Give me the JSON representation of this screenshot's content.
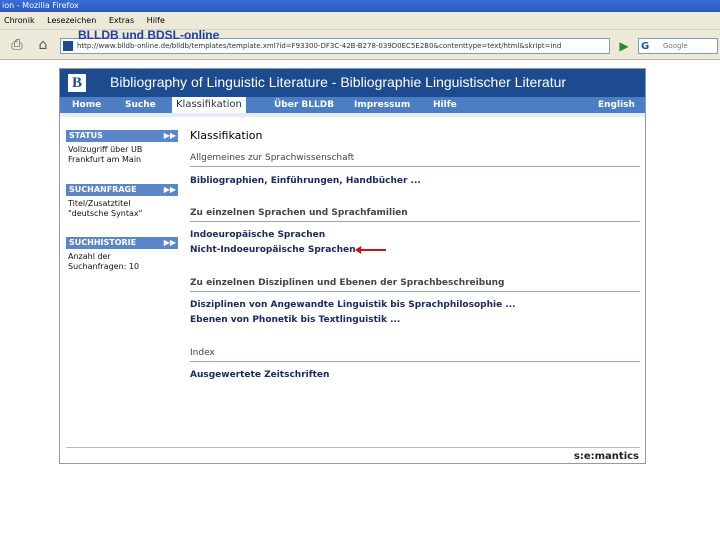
{
  "window": {
    "title": "ion - Mozilla Firefox"
  },
  "menu": [
    "Chronik",
    "Lesezeichen",
    "Extras",
    "Hilfe"
  ],
  "overlay_title": "BLLDB und BDSL-online",
  "address": {
    "url": "http://www.blldb-online.de/blldb/templates/template.xml?id=F93300-DF3C-42B-B278-039D0EC5E2B0&contenttype=text/html&skript=ind"
  },
  "search": {
    "placeholder": "Google"
  },
  "site": {
    "header_title": "Bibliography of Linguistic Literature - Bibliographie Linguistischer Literatur",
    "nav": [
      "Home",
      "Suche",
      "Klassifikation",
      "Über BLLDB",
      "Impressum",
      "Hilfe",
      "English"
    ],
    "brand": "s:e:mantics"
  },
  "sidebar": {
    "status": {
      "heading": "STATUS",
      "lines": [
        "Vollzugriff über UB",
        "Frankfurt am Main"
      ]
    },
    "suchanfrage": {
      "heading": "SUCHANFRAGE",
      "lines": [
        "Titel/Zusatztitel",
        "\"deutsche Syntax\""
      ]
    },
    "suchhistorie": {
      "heading": "SUCHHISTORIE",
      "lines": [
        "Anzahl der",
        "Suchanfragen: 10"
      ]
    }
  },
  "main": {
    "title": "Klassifikation",
    "sections": {
      "allgemeines": "Allgemeines zur Sprachwissenschaft",
      "bibliographien": "Bibliographien, Einführungen, Handbücher ...",
      "sprachen_heading": "Zu einzelnen Sprachen und Sprachfamilien",
      "indoeuropaeisch": "Indoeuropäische Sprachen",
      "nicht_indoeuropaeisch": "Nicht-Indoeuropäische Sprachen",
      "disziplinen_heading": "Zu einzelnen Disziplinen und Ebenen der Sprachbeschreibung",
      "disziplinen": "Disziplinen von Angewandte Linguistik bis Sprachphilosophie ...",
      "ebenen": "Ebenen von Phonetik bis Textlinguistik ...",
      "index": "Index",
      "zeitschriften": "Ausgewertete Zeitschriften"
    }
  }
}
